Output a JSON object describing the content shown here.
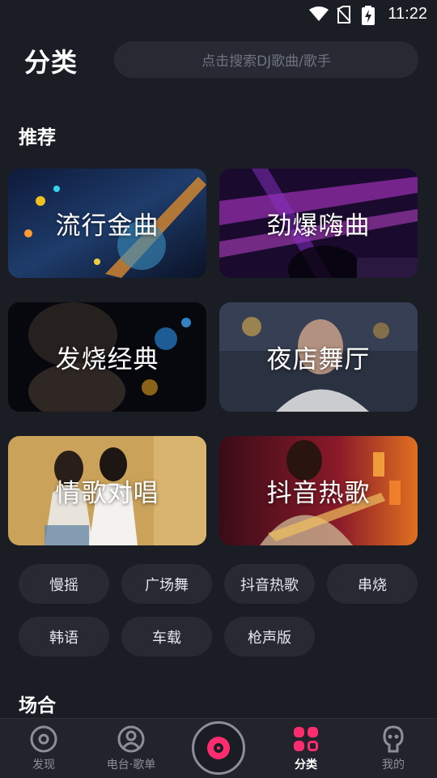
{
  "status_bar": {
    "time": "11:22"
  },
  "header": {
    "title": "分类",
    "search_placeholder": "点击搜索DJ歌曲/歌手"
  },
  "sections": {
    "recommend_title": "推荐",
    "occasion_title": "场合"
  },
  "cards": [
    {
      "label": "流行金曲"
    },
    {
      "label": "劲爆嗨曲"
    },
    {
      "label": "发烧经典"
    },
    {
      "label": "夜店舞厅"
    },
    {
      "label": "情歌对唱"
    },
    {
      "label": "抖音热歌"
    }
  ],
  "tags": [
    {
      "label": "慢摇"
    },
    {
      "label": "广场舞"
    },
    {
      "label": "抖音热歌"
    },
    {
      "label": "串烧"
    },
    {
      "label": "韩语"
    },
    {
      "label": "车载"
    },
    {
      "label": "枪声版"
    }
  ],
  "bottom_nav": {
    "items": [
      {
        "label": "发现",
        "icon": "discover-icon"
      },
      {
        "label": "电台·歌单",
        "icon": "radio-icon"
      },
      {
        "label": "分类",
        "icon": "category-icon",
        "active": true
      },
      {
        "label": "我的",
        "icon": "profile-icon"
      }
    ],
    "center_icon": "vinyl-disc-icon"
  },
  "colors": {
    "accent": "#ff2d6f",
    "background": "#1b1d24",
    "chip": "#272a33"
  }
}
